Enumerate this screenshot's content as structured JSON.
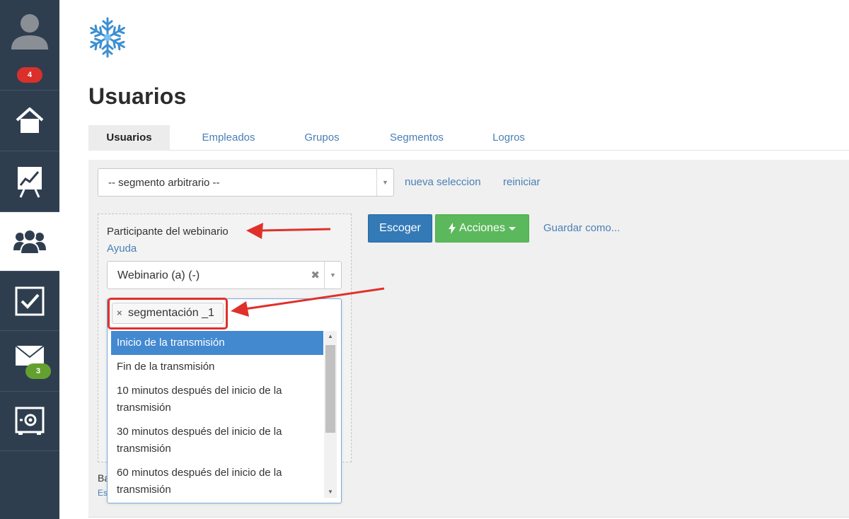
{
  "sidebar": {
    "notifications_badge": "4",
    "mail_badge": "3",
    "items": [
      {
        "name": "home"
      },
      {
        "name": "analytics"
      },
      {
        "name": "users",
        "active": true
      },
      {
        "name": "tasks"
      },
      {
        "name": "mail"
      },
      {
        "name": "settings"
      }
    ]
  },
  "page": {
    "title": "Usuarios"
  },
  "tabs": [
    {
      "label": "Usuarios",
      "active": true
    },
    {
      "label": "Empleados"
    },
    {
      "label": "Grupos"
    },
    {
      "label": "Segmentos"
    },
    {
      "label": "Logros"
    }
  ],
  "segment": {
    "selected": "-- segmento arbitrario --",
    "new_selection": "nueva seleccion",
    "reset": "reiniciar"
  },
  "filter": {
    "label": "Participante del webinario",
    "help": "Ayuda",
    "webinar_value": "Webinario (a) (-)",
    "chip": "segmentación _1",
    "options": [
      "Inicio de la transmisión",
      "Fin de la transmisión",
      "10 minutos después del inicio de la transmisión",
      "30 minutos después del inicio de la transmisión",
      "60 minutos después del inicio de la transmisión"
    ]
  },
  "actions": {
    "choose": "Escoger",
    "actions": "Acciones",
    "save_as": "Guardar como..."
  },
  "behind_text": {
    "line1": "Ba",
    "line2": "Es"
  },
  "colors": {
    "sidebar": "#2f3e4f",
    "primary": "#337ab7",
    "success": "#5cb85c",
    "link": "#4a7fb5",
    "highlight": "#e0302a",
    "selected_option": "#4289d0"
  }
}
